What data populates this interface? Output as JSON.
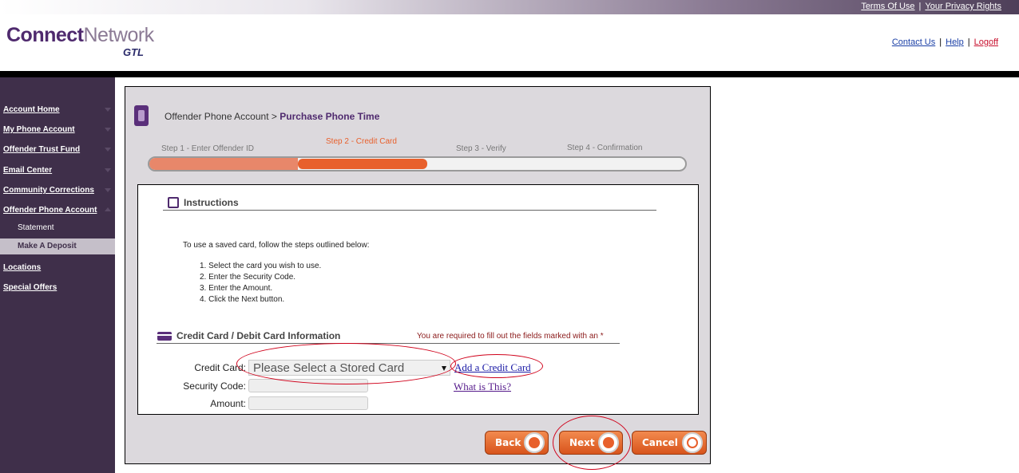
{
  "top_links": {
    "terms": "Terms Of Use",
    "separator": "|",
    "privacy": "Your Privacy Rights"
  },
  "logo": {
    "connect": "Connect",
    "network": "Network",
    "gtl": "GTL"
  },
  "header_links": {
    "contact": "Contact Us",
    "help": "Help",
    "logoff": "Logoff",
    "separator": "|"
  },
  "sidebar": {
    "items": [
      {
        "label": "Account Home"
      },
      {
        "label": "My Phone Account"
      },
      {
        "label": "Offender Trust Fund"
      },
      {
        "label": "Email Center"
      },
      {
        "label": "Community Corrections"
      },
      {
        "label": "Offender Phone Account"
      },
      {
        "label": "Locations"
      },
      {
        "label": "Special Offers"
      }
    ],
    "sub_items": [
      {
        "label": "Statement"
      },
      {
        "label": "Make A Deposit"
      }
    ]
  },
  "breadcrumb": {
    "parent": "Offender Phone Account >",
    "current": "Purchase Phone Time"
  },
  "wizard": {
    "steps": [
      "Step 1 - Enter Offender ID",
      "Step 2 - Credit Card",
      "Step 3 - Verify",
      "Step 4 - Confirmation"
    ],
    "current_step": 2
  },
  "instructions": {
    "title": "Instructions",
    "intro": "To use a saved card, follow the steps outlined below:",
    "steps": [
      "1.  Select the card you wish to use.",
      "2.  Enter the Security Code.",
      "3.  Enter the Amount.",
      "4.  Click the Next button."
    ]
  },
  "cc_section": {
    "title": "Credit Card / Debit Card Information",
    "required_note": "You are required to fill out the fields marked with an *",
    "credit_card_label": "Credit Card:",
    "credit_card_value": "Please Select a Stored Card",
    "add_card_link": "Add a Credit Card",
    "security_label": "Security Code:",
    "what_is_this_link": "What is This?",
    "amount_label": "Amount:"
  },
  "buttons": {
    "back": "Back",
    "next": "Next",
    "cancel": "Cancel"
  },
  "colors": {
    "brand_purple": "#4f2a6e",
    "sidebar_bg": "#3f2f4a",
    "accent_orange": "#e8602c",
    "highlight_red": "#d0021b"
  }
}
